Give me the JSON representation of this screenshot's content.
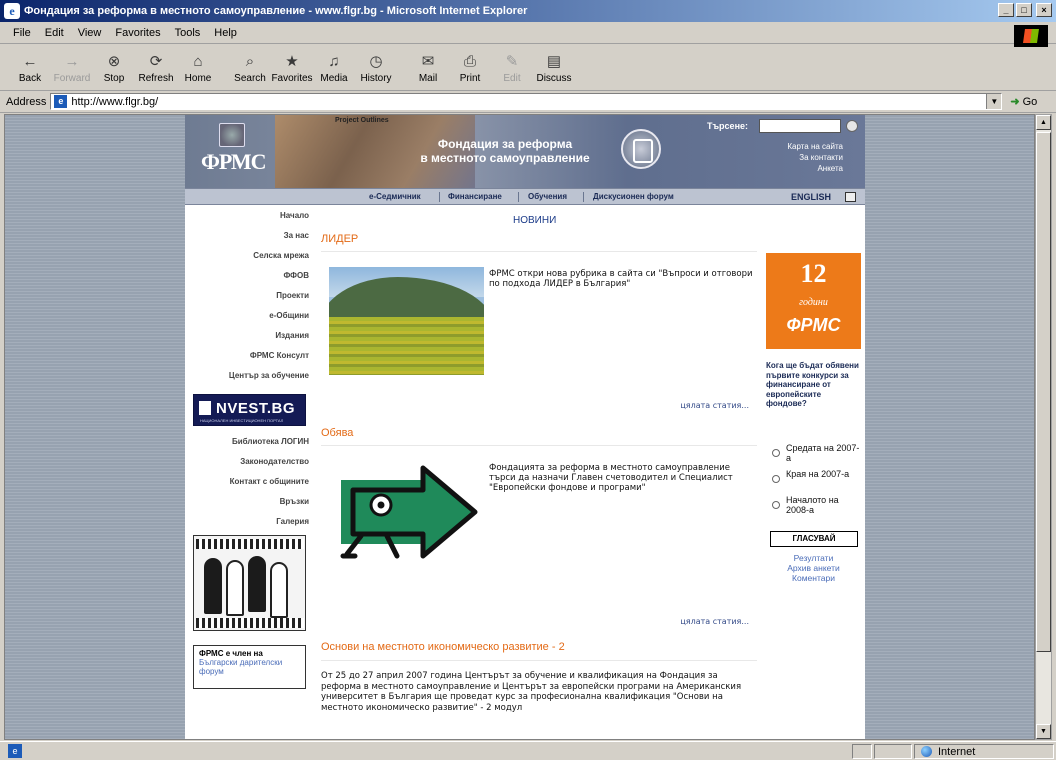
{
  "window": {
    "title": "Фондация за реформа в местното самоуправление - www.flgr.bg - Microsoft Internet Explorer",
    "minimize": "_",
    "maximize": "□",
    "close": "×"
  },
  "menu": [
    "File",
    "Edit",
    "View",
    "Favorites",
    "Tools",
    "Help"
  ],
  "toolbar": [
    {
      "label": "Back",
      "icon": "←"
    },
    {
      "label": "Forward",
      "icon": "→"
    },
    {
      "label": "Stop",
      "icon": "⊗"
    },
    {
      "label": "Refresh",
      "icon": "⟳"
    },
    {
      "label": "Home",
      "icon": "⌂"
    },
    {
      "label": "Search",
      "icon": "⌕"
    },
    {
      "label": "Favorites",
      "icon": "★"
    },
    {
      "label": "Media",
      "icon": "♫"
    },
    {
      "label": "History",
      "icon": "◷"
    },
    {
      "label": "Mail",
      "icon": "✉"
    },
    {
      "label": "Print",
      "icon": "⎙"
    },
    {
      "label": "Edit",
      "icon": "✎"
    },
    {
      "label": "Discuss",
      "icon": "▤"
    }
  ],
  "address": {
    "label": "Address",
    "url": "http://www.flgr.bg/",
    "go": "Go"
  },
  "site": {
    "logo_text": "ФРМС",
    "banner_tag": "Project Outlines",
    "foundation_name_line1": "Фондация за реформа",
    "foundation_name_line2": "в местното самоуправление",
    "search_label": "Търсене:",
    "top_links": [
      "Карта на сайта",
      "За контакти",
      "Анкета"
    ],
    "nav": [
      "е-Седмичник",
      "Финансиране",
      "Обучения",
      "Дискусионен форум"
    ],
    "english": "ENGLISH"
  },
  "left_nav": {
    "items_top": [
      "Начало",
      "За нас",
      "Селска мрежа",
      "ФФОВ",
      "Проекти",
      "е-Общини",
      "Издания",
      "ФРМС Консулт",
      "Център за обучение"
    ],
    "nvest_text": "NVEST.BG",
    "nvest_sub": "НАЦИОНАЛЕН ИНВЕСТИЦИОНЕН ПОРТАЛ",
    "items_bottom": [
      "Библиотека ЛОГИН",
      "Законодателство",
      "Контакт с общините",
      "Връзки",
      "Галерия"
    ],
    "member_title": "ФРМС е член на",
    "member_link": "Български дарителски форум"
  },
  "main": {
    "heading": "НОВИНИ",
    "articles": [
      {
        "title": "ЛИДЕР",
        "text": "ФРМС откри нова рубрика в сайта си \"Въпроси и отговори по подхода ЛИДЕР в България\"",
        "more": "цялата статия..."
      },
      {
        "title": "Обява",
        "text": "Фондацията за реформа в местното самоуправление търси да назначи Главен счетоводител и Специалист \"Европейски фондове и програми\"",
        "more": "цялата статия..."
      },
      {
        "title": "Основи на местното икономическо развитие - 2",
        "text": "От 25 до 27 април 2007 година Центърът за обучение и квалификация на Фондация за реформа в местното самоуправление и Центърът за европейски програми на Американския университет в България ще проведат курс за професионална квалификация \"Основи на местното икономическо развитие\" - 2 модул"
      }
    ]
  },
  "right": {
    "badge_number": "12",
    "badge_sub": "години",
    "badge_brand": "ФРМС",
    "poll_question": "Кога ще бъдат обявени първите конкурси за финансиране от европейските фондове?",
    "options": [
      "Средата на 2007-а",
      "Края на 2007-а",
      "Началото на 2008-а"
    ],
    "vote": "ГЛАСУВАЙ",
    "links": [
      "Резултати",
      "Архив анкети",
      "Коментари"
    ]
  },
  "status": {
    "zone": "Internet"
  },
  "colors": {
    "accent_orange": "#e36a16",
    "link_blue": "#4a6cb8",
    "title_bar": "#0a246a"
  }
}
